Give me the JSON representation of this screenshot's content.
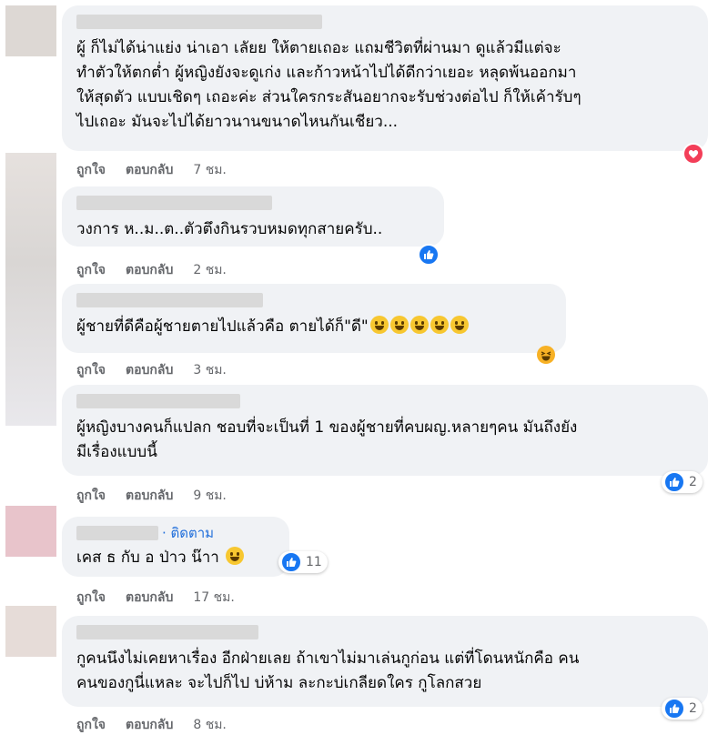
{
  "colors": {
    "like": "#1877f2",
    "love": "#f33e58",
    "link": "#216fdb",
    "meta": "#65676b",
    "bubble": "#f0f2f5"
  },
  "labels": {
    "like": "ถูกใจ",
    "reply": "ตอบกลับ"
  },
  "comments": [
    {
      "text": "ผู้ ก็ไม่ได้น่าแย่ง น่าเอา เลัยย ให้ตายเถอะ แถมชีวิตที่ผ่านมา ดูแล้วมีแต่จะ\nทำตัวให้ตกต่ำ ผู้หญิงยังจะดูเก่ง และก้าวหน้าไปได้ดีกว่าเยอะ หลุดพ้นออกมา\nให้สุดตัว แบบเชิดๆ เถอะค่ะ ส่วนใครกระสันอยากจะรับช่วงต่อไป ก็ให้เค้ารับๆ\nไปเถอะ มันจะไปได้ยาวนานขนาดไหนกันเชียว...",
      "time": "7 ชม.",
      "reaction": {
        "type": "love-icon",
        "count": ""
      }
    },
    {
      "text": "วงการ ห..ม..ต..ตัวตึงกินรวบหมดทุกสายครับ..",
      "time": "2 ชม.",
      "reaction": {
        "type": "like-icon",
        "count": ""
      }
    },
    {
      "text": "ผู้ชายที่ดีคือผู้ชายตายไปแล้วคือ ตายได้ก็\"ดี\"",
      "time": "3 ชม.",
      "reaction": {
        "type": "haha-icon",
        "count": ""
      }
    },
    {
      "text": "ผู้หญิงบางคนก็แปลก ชอบที่จะเป็นที่ 1 ของผู้ชายที่คบผญ.หลายๆคน มันถึงยัง\nมีเรื่องแบบนี้",
      "time": "9 ชม.",
      "reaction": {
        "type": "like-icon",
        "count": "2"
      }
    },
    {
      "follow": "· ติดตาม",
      "text": "เคส ธ กับ อ ป่าว น๊าา",
      "time": "17 ชม.",
      "reaction": {
        "type": "like-icon",
        "count": "11"
      }
    },
    {
      "text": "กูคนนึงไม่เคยหาเรื่อง อีกฝ่ายเลย ถ้าเขาไม่มาเล่นกูก่อน แต่ที่โดนหนักคือ คน\nคนของกูนี่แหละ จะไปก็ไป บ่ห้าม ละกะบ่เกลียดใคร กูโลกสวย",
      "time": "8 ชม.",
      "reaction": {
        "type": "like-icon",
        "count": "2"
      }
    }
  ]
}
